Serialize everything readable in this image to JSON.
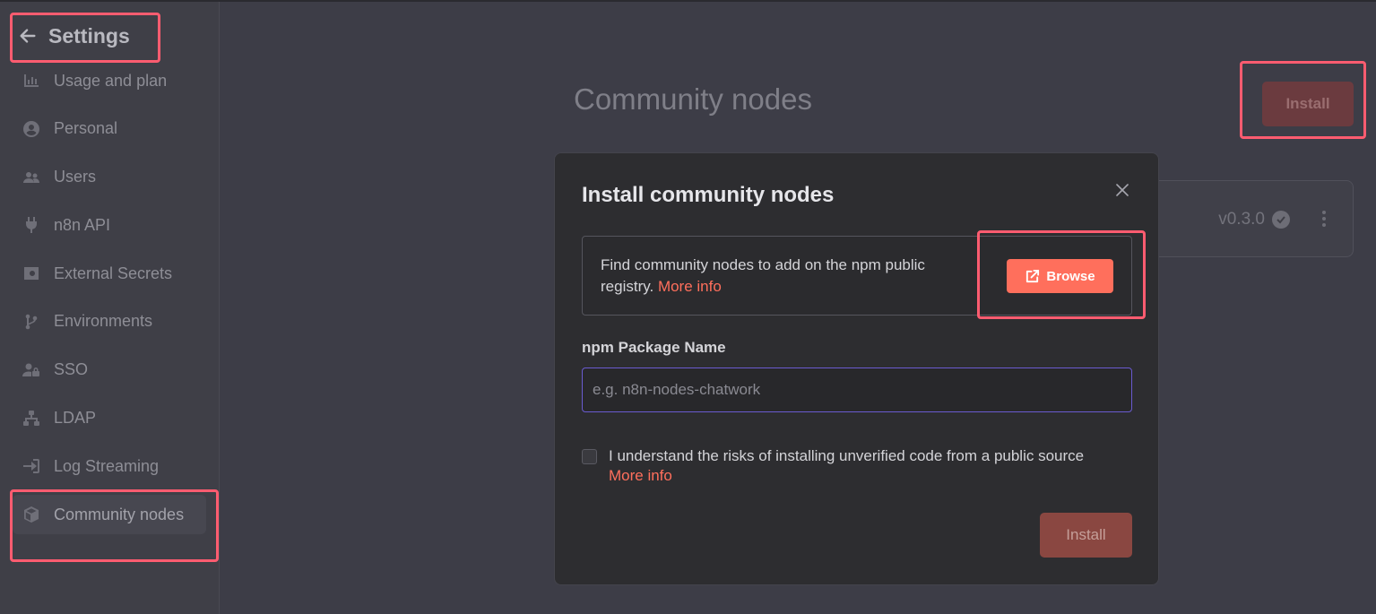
{
  "sidebar": {
    "back_label": "Settings",
    "items": [
      {
        "label": "Usage and plan",
        "icon": "bar-chart-icon"
      },
      {
        "label": "Personal",
        "icon": "user-circle-icon"
      },
      {
        "label": "Users",
        "icon": "users-icon"
      },
      {
        "label": "n8n API",
        "icon": "plug-icon"
      },
      {
        "label": "External Secrets",
        "icon": "vault-icon"
      },
      {
        "label": "Environments",
        "icon": "git-branch-icon"
      },
      {
        "label": "SSO",
        "icon": "user-lock-icon"
      },
      {
        "label": "LDAP",
        "icon": "network-icon"
      },
      {
        "label": "Log Streaming",
        "icon": "sign-in-icon"
      },
      {
        "label": "Community nodes",
        "icon": "cube-icon",
        "active": true
      }
    ]
  },
  "main": {
    "title": "Community nodes",
    "install_label": "Install",
    "package_card": {
      "version": "v0.3.0"
    }
  },
  "modal": {
    "title": "Install community nodes",
    "info_text": "Find community nodes to add on the npm public registry.",
    "info_link": "More info",
    "browse_label": "Browse",
    "field_label": "npm Package Name",
    "input_placeholder": "e.g. n8n-nodes-chatwork",
    "input_value": "",
    "consent_text": "I understand the risks of installing unverified code from a public source",
    "consent_link": "More info",
    "install_label": "Install"
  },
  "colors": {
    "accent": "#ff6f5c",
    "highlight": "#ff5c70",
    "input_focus": "#6a5bd0"
  }
}
